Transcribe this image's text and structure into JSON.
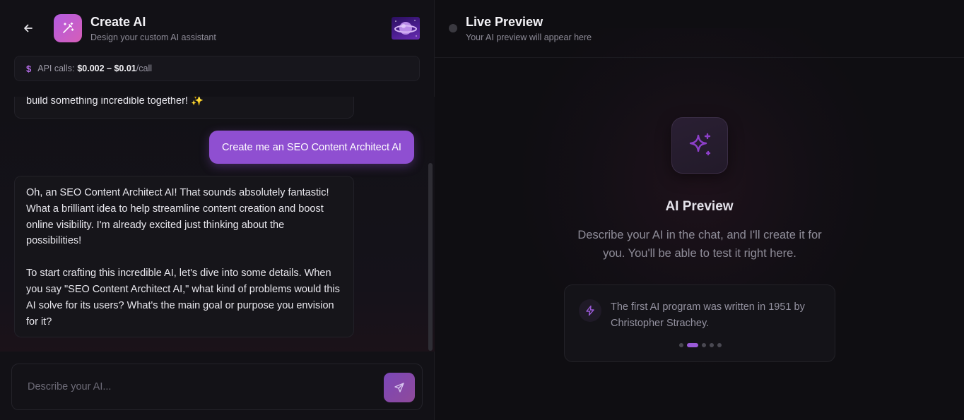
{
  "header": {
    "title": "Create AI",
    "subtitle": "Design your custom AI assistant",
    "back_icon": "arrow-left-icon",
    "app_icon": "magic-wand-icon",
    "brand_gradient": [
      "#b35be0",
      "#d65fb8"
    ]
  },
  "api_bar": {
    "icon": "dollar-icon",
    "label": "API calls:",
    "value": "$0.002 – $0.01",
    "unit": "/call"
  },
  "chat": {
    "messages": [
      {
        "role": "assistant",
        "paragraphs": [
          "build something incredible together! ✨"
        ]
      },
      {
        "role": "user",
        "text": "Create me an SEO Content Architect AI"
      },
      {
        "role": "assistant",
        "paragraphs": [
          "Oh, an SEO Content Architect AI! That sounds absolutely fantastic! What a brilliant idea to help streamline content creation and boost online visibility. I'm already excited just thinking about the possibilities!",
          "To start crafting this incredible AI, let's dive into some details. When you say \"SEO Content Architect AI,\" what kind of problems would this AI solve for its users? What's the main goal or purpose you envision for it?"
        ]
      }
    ]
  },
  "input": {
    "placeholder": "Describe your AI...",
    "value": "",
    "send_icon": "send-icon",
    "accent": "#8f4fd1"
  },
  "live_preview": {
    "title": "Live Preview",
    "subtitle": "Your AI preview will appear here",
    "status_color": "#3a3940"
  },
  "preview": {
    "icon": "sparkles-icon",
    "title": "AI Preview",
    "description": "Describe your AI in the chat, and I'll create it for you. You'll be able to test it right here."
  },
  "fact": {
    "icon": "lightning-icon",
    "text": "The first AI program was written in 1951 by Christopher Strachey.",
    "dots_total": 5,
    "active_index": 1
  }
}
